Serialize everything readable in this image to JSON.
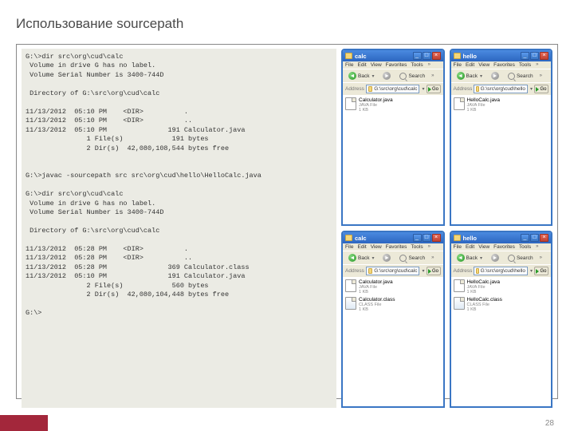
{
  "slide": {
    "title": "Использование sourcepath",
    "page_number": "28"
  },
  "terminal_text": "G:\\>dir src\\org\\cud\\calc\n Volume in drive G has no label.\n Volume Serial Number is 3400-744D\n\n Directory of G:\\src\\org\\cud\\calc\n\n11/13/2012  05:10 PM    <DIR>          .\n11/13/2012  05:10 PM    <DIR>          ..\n11/13/2012  05:10 PM               191 Calculator.java\n               1 File(s)            191 bytes\n               2 Dir(s)  42,080,108,544 bytes free\n\n\nG:\\>javac -sourcepath src src\\org\\cud\\hello\\HelloCalc.java\n\nG:\\>dir src\\org\\cud\\calc\n Volume in drive G has no label.\n Volume Serial Number is 3400-744D\n\n Directory of G:\\src\\org\\cud\\calc\n\n11/13/2012  05:28 PM    <DIR>          .\n11/13/2012  05:28 PM    <DIR>          ..\n11/13/2012  05:28 PM               369 Calculator.class\n11/13/2012  05:10 PM               191 Calculator.java\n               2 File(s)            560 bytes\n               2 Dir(s)  42,080,104,448 bytes free\n\nG:\\>",
  "explorer_common": {
    "menu": [
      "File",
      "Edit",
      "View",
      "Favorites",
      "Tools"
    ],
    "btn_back": "Back",
    "btn_search": "Search",
    "addr_label": "Address",
    "go_label": "Go",
    "file_type_java": "JAVA File",
    "file_type_class": "CLASS File",
    "file_size": "1 KB"
  },
  "windows": [
    {
      "title": "calc",
      "path": "G:\\src\\org\\cud\\calc",
      "files": [
        {
          "name": "Calculator.java",
          "type": "java"
        }
      ]
    },
    {
      "title": "hello",
      "path": "G:\\src\\org\\cud\\hello",
      "files": [
        {
          "name": "HelloCalc.java",
          "type": "java"
        }
      ]
    },
    {
      "title": "calc",
      "path": "G:\\src\\org\\cud\\calc",
      "files": [
        {
          "name": "Calculator.java",
          "type": "java"
        },
        {
          "name": "Calculator.class",
          "type": "class"
        }
      ]
    },
    {
      "title": "hello",
      "path": "G:\\src\\org\\cud\\hello",
      "files": [
        {
          "name": "HelloCalc.java",
          "type": "java"
        },
        {
          "name": "HelloCalc.class",
          "type": "class"
        }
      ]
    }
  ]
}
